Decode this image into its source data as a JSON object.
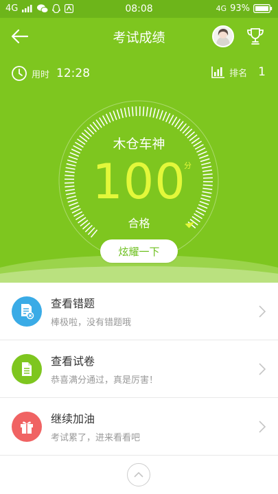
{
  "status_bar": {
    "left_network": "4G",
    "time": "08:08",
    "right_network": "4G",
    "battery": "93%"
  },
  "header": {
    "title": "考试成绩",
    "back_icon": "back-arrow-icon",
    "trophy_icon": "trophy-icon"
  },
  "stats": {
    "time_label": "用时",
    "time_value": "12:28",
    "rank_label": "排名",
    "rank_value": "1"
  },
  "score_card": {
    "player_name": "木仓车神",
    "score": "100",
    "score_unit": "分",
    "score_fraction": 1.0,
    "result": "合格",
    "share_label": "炫耀一下"
  },
  "list": {
    "items": [
      {
        "title": "查看错题",
        "subtitle": "棒极啦，没有错题哦",
        "icon": "wrong-answers-icon",
        "color": "#3aabe6"
      },
      {
        "title": "查看试卷",
        "subtitle": "恭喜满分通过，真是厉害！",
        "icon": "document-icon",
        "color": "#7ec61f"
      },
      {
        "title": "继续加油",
        "subtitle": "考试累了，进来看看吧",
        "icon": "gift-icon",
        "color": "#f06363"
      }
    ]
  },
  "colors": {
    "primary_green": "#7ec61f",
    "score_yellow": "#e3f83a"
  }
}
